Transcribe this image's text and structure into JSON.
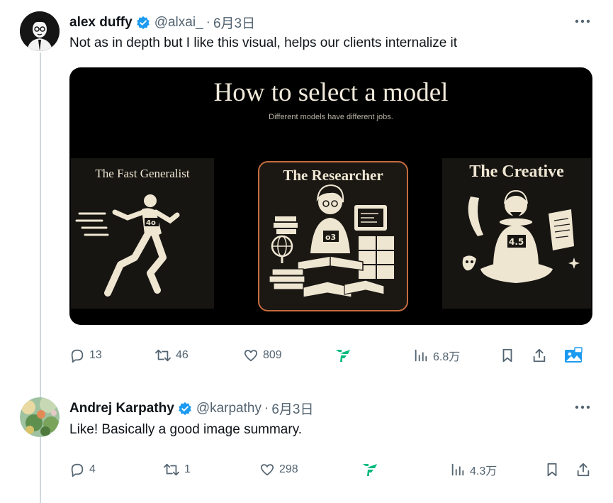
{
  "tweets": [
    {
      "author": "alex duffy",
      "handle": "@alxai_",
      "separator": "·",
      "date": "6月3日",
      "text": "Not as in depth but I like this visual, helps our clients internalize it",
      "media": {
        "title": "How to select a model",
        "subtitle": "Different models have different jobs.",
        "panels": [
          {
            "label": "The Fast Generalist",
            "figure": "running-man",
            "badge": "4o"
          },
          {
            "label": "The Researcher",
            "figure": "researcher-at-desk",
            "badge": "o3"
          },
          {
            "label": "The Creative",
            "figure": "shakespeare-writer",
            "badge": "4.5"
          }
        ]
      },
      "stats": {
        "replies": "13",
        "reposts": "46",
        "likes": "809",
        "views": "6.8万"
      }
    },
    {
      "author": "Andrej Karpathy",
      "handle": "@karpathy",
      "separator": "·",
      "date": "6月3日",
      "text": "Like! Basically a good image summary.",
      "stats": {
        "replies": "4",
        "reposts": "1",
        "likes": "298",
        "views": "4.3万"
      }
    }
  ],
  "colors": {
    "verified": "#1d9bf0",
    "grok": "#00ba7c",
    "muted": "#536471",
    "thread": "#cfd9de"
  },
  "icons": [
    "reply-icon",
    "repost-icon",
    "like-icon",
    "grok-icon",
    "views-icon",
    "bookmark-icon",
    "share-icon",
    "media-icon",
    "more-icon",
    "verified-badge-icon"
  ]
}
